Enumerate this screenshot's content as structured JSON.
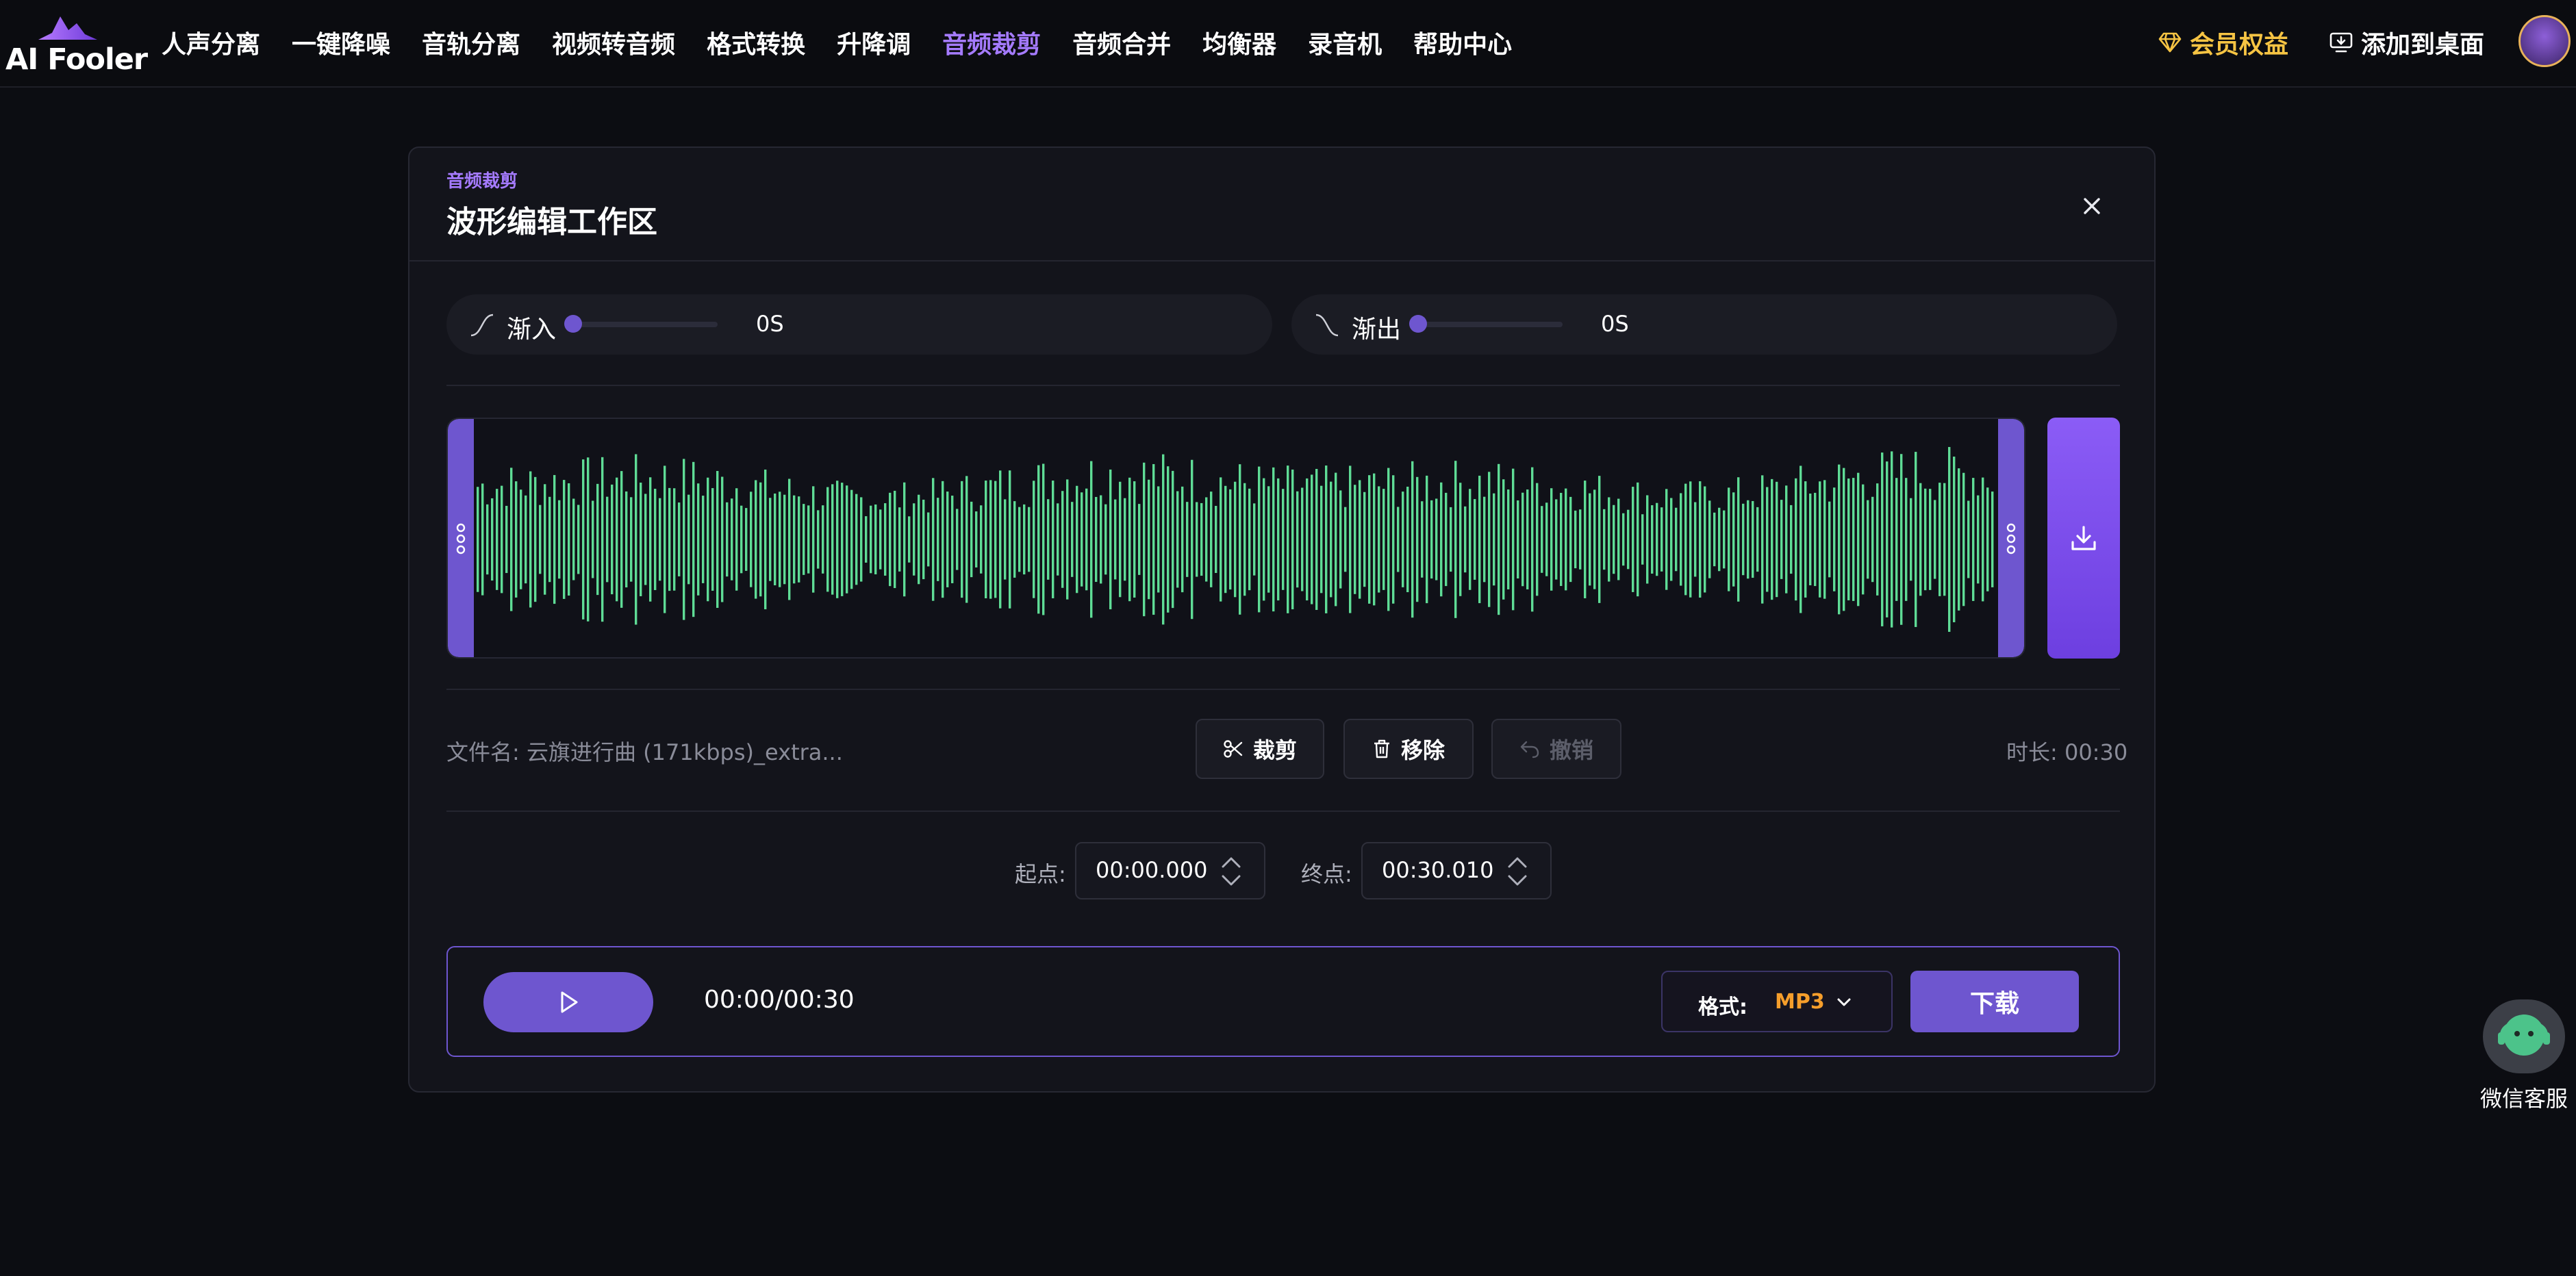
{
  "header": {
    "logo_text": "AI Fooler",
    "nav": [
      {
        "label": "人声分离",
        "active": false
      },
      {
        "label": "一键降噪",
        "active": false
      },
      {
        "label": "音轨分离",
        "active": false
      },
      {
        "label": "视频转音频",
        "active": false
      },
      {
        "label": "格式转换",
        "active": false
      },
      {
        "label": "升降调",
        "active": false
      },
      {
        "label": "音频裁剪",
        "active": true
      },
      {
        "label": "音频合并",
        "active": false
      },
      {
        "label": "均衡器",
        "active": false
      },
      {
        "label": "录音机",
        "active": false
      },
      {
        "label": "帮助中心",
        "active": false
      }
    ],
    "member_label": "会员权益",
    "add_desktop_label": "添加到桌面"
  },
  "panel": {
    "kicker": "音频裁剪",
    "title": "波形编辑工作区",
    "fade_in": {
      "label": "渐入",
      "value": "0S",
      "level": 0
    },
    "fade_out": {
      "label": "渐出",
      "value": "0S",
      "level": 0
    },
    "file_name": "文件名: 云旗进行曲 (171kbps)_extra...",
    "buttons": {
      "cut": "裁剪",
      "remove": "移除",
      "undo": "撤销"
    },
    "duration": "时长: 00:30",
    "start": {
      "label": "起点:",
      "value": "00:00.000"
    },
    "end": {
      "label": "终点:",
      "value": "00:30.010"
    },
    "player": {
      "time": "00:00/00:30",
      "format_label": "格式:",
      "format_value": "MP3",
      "download_label": "下载"
    }
  },
  "service": {
    "label": "微信客服"
  },
  "colors": {
    "accent": "#6e56cf",
    "nav_active": "#a57bff",
    "member": "#f6c443",
    "waveform": "#5fdc96",
    "format_value": "#f59e2b"
  }
}
